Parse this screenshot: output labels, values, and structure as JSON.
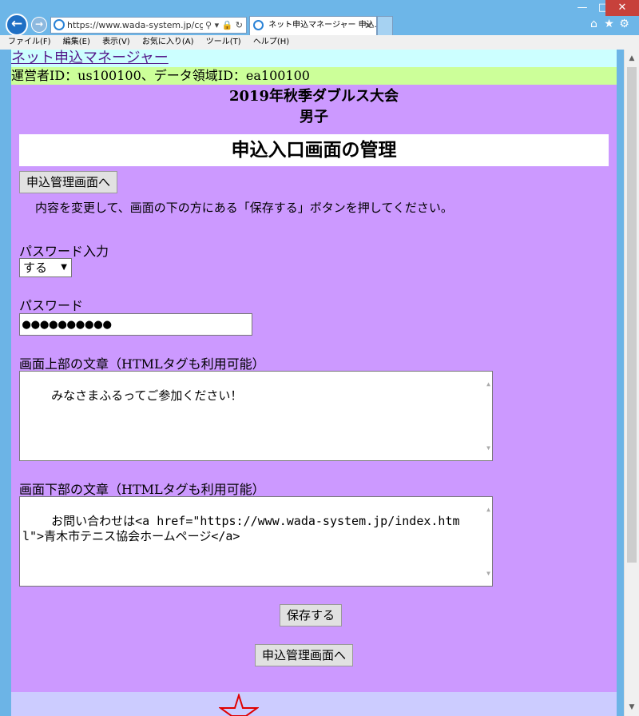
{
  "browser": {
    "address_url": "https://www.wada-system.jp/cgi-bir",
    "tab_title": "ネット申込マネージャー 申込...",
    "menu": [
      "ファイル(F)",
      "編集(E)",
      "表示(V)",
      "お気に入り(A)",
      "ツール(T)",
      "ヘルプ(H)"
    ]
  },
  "page": {
    "site_link": "ネット申込マネージャー",
    "operator_line": "運営者ID：us100100、データ領域ID：ea100100",
    "event_title": "2019年秋季ダブルス大会",
    "event_category": "男子",
    "page_heading": "申込入口画面の管理",
    "top_button": "申込管理画面へ",
    "instruction": "内容を変更して、画面の下の方にある「保存する」ボタンを押してください。",
    "password_input_label": "パスワード入力",
    "password_input_value": "する",
    "password_label": "パスワード",
    "password_value": "●●●●●●●●●●",
    "top_text_label": "画面上部の文章（HTMLタグも利用可能）",
    "top_text_value": "みなさまふるってご参加ください！",
    "bottom_text_label": "画面下部の文章（HTMLタグも利用可能）",
    "bottom_text_value": "お問い合わせは<a href=\"https://www.wada-system.jp/index.html\">青木市テニス協会ホームページ</a>",
    "save_button": "保存する",
    "bottom_button": "申込管理画面へ"
  }
}
